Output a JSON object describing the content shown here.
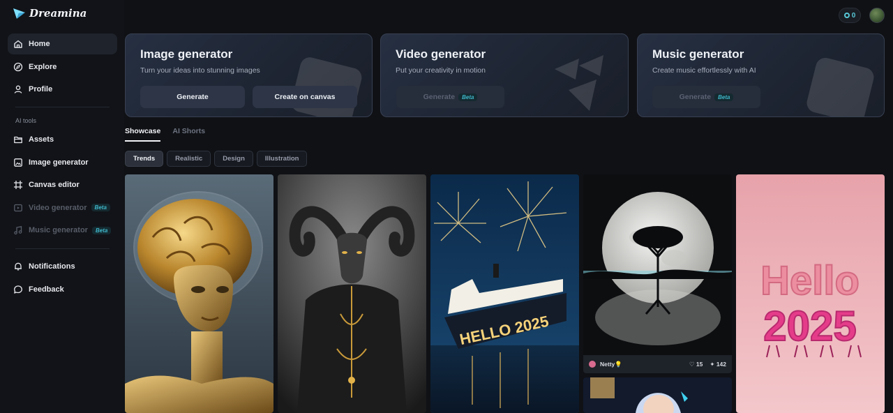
{
  "app": {
    "name": "Dreamina"
  },
  "sidebar": {
    "items": [
      {
        "label": "Home",
        "icon": "home-icon"
      },
      {
        "label": "Explore",
        "icon": "compass-icon"
      },
      {
        "label": "Profile",
        "icon": "user-icon"
      }
    ],
    "section_label": "AI tools",
    "tools": [
      {
        "label": "Assets",
        "icon": "folder-icon"
      },
      {
        "label": "Image generator",
        "icon": "image-gen-icon"
      },
      {
        "label": "Canvas editor",
        "icon": "canvas-icon"
      },
      {
        "label": "Video generator",
        "icon": "video-icon",
        "badge": "Beta"
      },
      {
        "label": "Music generator",
        "icon": "music-icon",
        "badge": "Beta"
      }
    ],
    "bottom": [
      {
        "label": "Notifications",
        "icon": "bell-icon"
      },
      {
        "label": "Feedback",
        "icon": "chat-icon"
      }
    ]
  },
  "header": {
    "credits": "0"
  },
  "cards": [
    {
      "title": "Image generator",
      "subtitle": "Turn your ideas into stunning images",
      "primary": "Generate",
      "secondary": "Create on canvas"
    },
    {
      "title": "Video generator",
      "subtitle": "Put your creativity in motion",
      "primary": "Generate",
      "badge": "Beta"
    },
    {
      "title": "Music generator",
      "subtitle": "Create music effortlessly with AI",
      "primary": "Generate",
      "badge": "Beta"
    }
  ],
  "tabs": [
    "Showcase",
    "AI Shorts"
  ],
  "filters": [
    "Trends",
    "Realistic",
    "Design",
    "Illustration"
  ],
  "gallery": [
    {
      "icon": "golden-robot-image"
    },
    {
      "icon": "goat-image"
    },
    {
      "icon": "cruise-ship-image",
      "text": "HELLO 2025"
    },
    {
      "icon": "moon-tree-image",
      "author": "Netty💡",
      "likes": "15",
      "remixes": "142"
    },
    {
      "icon": "hello-2025-image",
      "line1": "Hello",
      "line2": "2025"
    },
    {
      "icon": "blue-hair-girl-image"
    }
  ],
  "colors": {
    "accent": "#3fb6c9",
    "background": "#0f1115",
    "card": "#1e2533"
  }
}
